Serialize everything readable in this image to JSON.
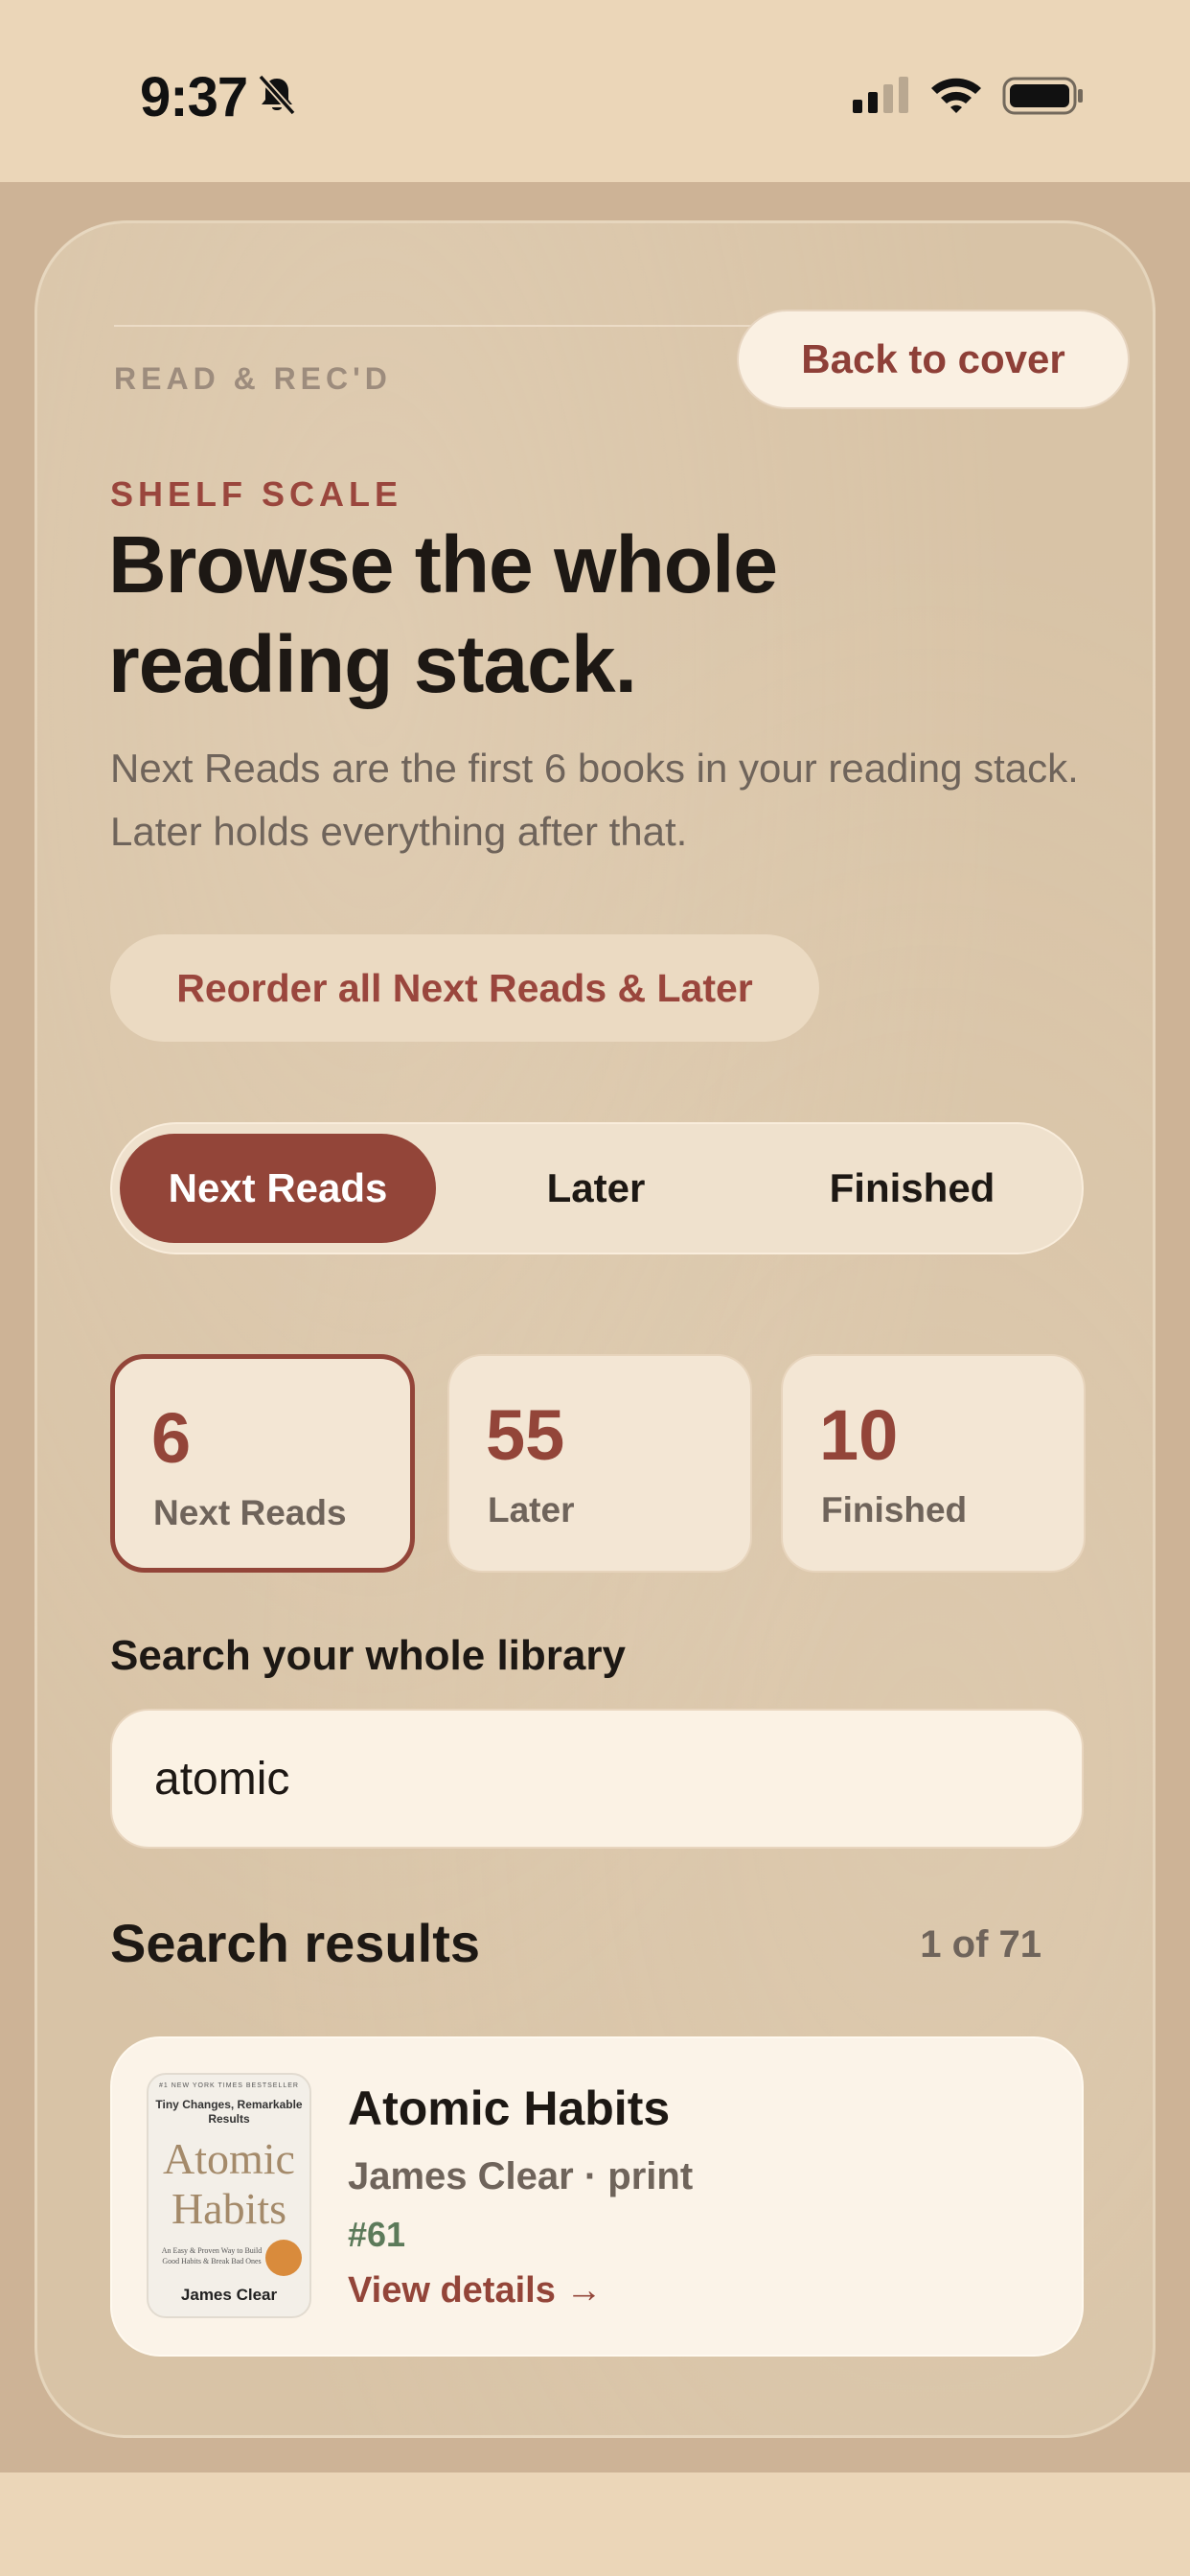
{
  "status_bar": {
    "time": "9:37"
  },
  "header": {
    "brand": "READ & REC'D",
    "back_label": "Back to cover"
  },
  "intro": {
    "eyebrow": "SHELF SCALE",
    "headline_line1": "Browse the whole",
    "headline_line2": "reading stack.",
    "description": "Next Reads are the first 6 books in your reading stack. Later holds everything after that.",
    "reorder_label": "Reorder all Next Reads & Later"
  },
  "tabs": [
    {
      "label": "Next Reads",
      "active": true
    },
    {
      "label": "Later",
      "active": false
    },
    {
      "label": "Finished",
      "active": false
    }
  ],
  "stats": [
    {
      "value": "6",
      "label": "Next Reads",
      "active": true
    },
    {
      "value": "55",
      "label": "Later",
      "active": false
    },
    {
      "value": "10",
      "label": "Finished",
      "active": false
    }
  ],
  "search": {
    "label": "Search your whole library",
    "value": "atomic"
  },
  "results": {
    "title": "Search results",
    "count": "1 of 71",
    "items": [
      {
        "title": "Atomic Habits",
        "meta": "James Clear · print",
        "rank": "#61",
        "link": "View details →",
        "cover": {
          "top": "#1 NEW YORK TIMES BESTSELLER",
          "subtitle": "Tiny Changes, Remarkable Results",
          "title_line1": "Atomic",
          "title_line2": "Habits",
          "blurb": "An Easy & Proven Way to Build Good Habits & Break Bad Ones",
          "author": "James Clear"
        }
      }
    ]
  },
  "colors": {
    "accent": "#934539",
    "background": "#ebd6b8",
    "card": "#d8c3a6",
    "rank": "#5c7a5a"
  }
}
